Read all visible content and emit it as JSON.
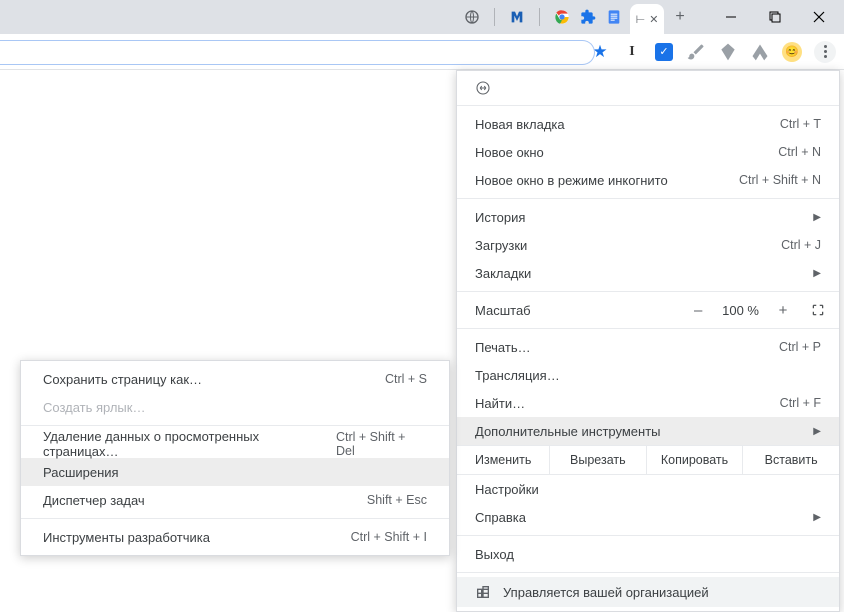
{
  "menu": {
    "new_tab": {
      "label": "Новая вкладка",
      "shortcut": "Ctrl + T"
    },
    "new_window": {
      "label": "Новое окно",
      "shortcut": "Ctrl + N"
    },
    "incognito": {
      "label": "Новое окно в режиме инкогнито",
      "shortcut": "Ctrl + Shift + N"
    },
    "history": {
      "label": "История"
    },
    "downloads": {
      "label": "Загрузки",
      "shortcut": "Ctrl + J"
    },
    "bookmarks": {
      "label": "Закладки"
    },
    "zoom": {
      "label": "Масштаб",
      "value": "100 %"
    },
    "print": {
      "label": "Печать…",
      "shortcut": "Ctrl + P"
    },
    "cast": {
      "label": "Трансляция…"
    },
    "find": {
      "label": "Найти…",
      "shortcut": "Ctrl + F"
    },
    "more_tools": {
      "label": "Дополнительные инструменты"
    },
    "edit": {
      "label": "Изменить",
      "cut": "Вырезать",
      "copy": "Копировать",
      "paste": "Вставить"
    },
    "settings": {
      "label": "Настройки"
    },
    "help": {
      "label": "Справка"
    },
    "exit": {
      "label": "Выход"
    },
    "managed": {
      "label": "Управляется вашей организацией"
    }
  },
  "submenu": {
    "save_page": {
      "label": "Сохранить страницу как…",
      "shortcut": "Ctrl + S"
    },
    "create_shortcut": {
      "label": "Создать ярлык…"
    },
    "clear_data": {
      "label": "Удаление данных о просмотренных страницах…",
      "shortcut": "Ctrl + Shift + Del"
    },
    "extensions": {
      "label": "Расширения"
    },
    "task_manager": {
      "label": "Диспетчер задач",
      "shortcut": "Shift + Esc"
    },
    "dev_tools": {
      "label": "Инструменты разработчика",
      "shortcut": "Ctrl + Shift + I"
    }
  }
}
